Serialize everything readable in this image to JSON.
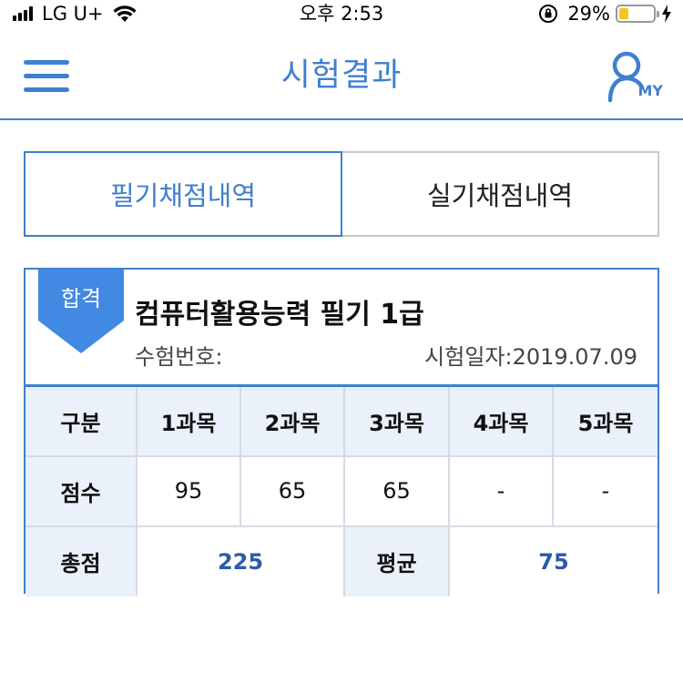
{
  "status_bar": {
    "carrier": "LG U+",
    "time": "오후 2:53",
    "battery_percent": "29%",
    "battery_level": 0.29,
    "signal_icon": "signal-bars-icon",
    "wifi_icon": "wifi-icon",
    "rotation_lock_icon": "rotation-lock-icon",
    "charging_icon": "bolt-icon"
  },
  "nav": {
    "title": "시험결과",
    "menu_icon": "hamburger-menu-icon",
    "my_label": "MY",
    "my_icon": "user-icon"
  },
  "tabs": [
    {
      "label": "필기채점내역",
      "active": true
    },
    {
      "label": "실기채점내역",
      "active": false
    }
  ],
  "result": {
    "badge": "합격",
    "exam_name": "컴퓨터활용능력 필기 1급",
    "exam_number_label": "수험번호:",
    "exam_date_label": "시험일자:2019.07.09"
  },
  "score_table": {
    "header": [
      "구분",
      "1과목",
      "2과목",
      "3과목",
      "4과목",
      "5과목"
    ],
    "scores": [
      "점수",
      "95",
      "65",
      "65",
      "-",
      "-"
    ],
    "total_label": "총점",
    "total_value": "225",
    "average_label": "평균",
    "average_value": "75"
  },
  "colors": {
    "accent": "#3f7fd0",
    "header_bg": "#eaf1fb",
    "value_blue": "#2c5aa8",
    "battery": "#f5c51b"
  }
}
